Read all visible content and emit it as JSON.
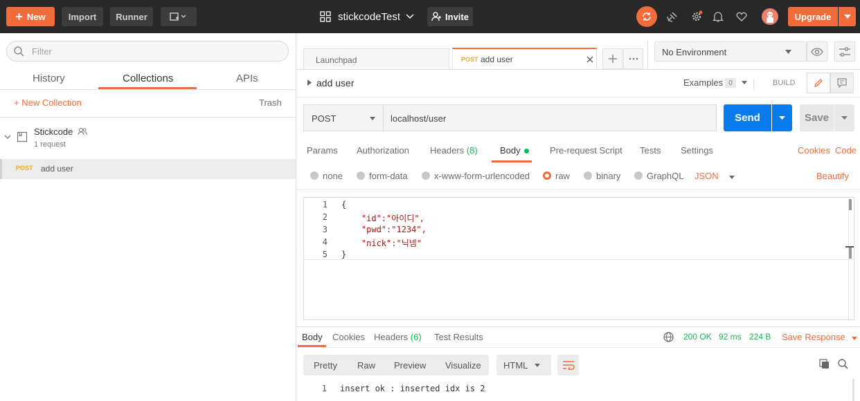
{
  "topbar": {
    "new_label": "New",
    "import_label": "Import",
    "runner_label": "Runner",
    "workspace_name": "stickcodeTest",
    "invite_label": "Invite",
    "upgrade_label": "Upgrade"
  },
  "sidebar": {
    "filter_placeholder": "Filter",
    "tabs": [
      "History",
      "Collections",
      "APIs"
    ],
    "new_collection_label": "+ New Collection",
    "trash_label": "Trash",
    "collection": {
      "name": "Stickcode",
      "count": "1 request"
    },
    "request": {
      "method": "POST",
      "name": "add user"
    }
  },
  "tabs": {
    "launchpad_label": "Launchpad",
    "active_method": "POST",
    "active_name": "add user"
  },
  "env": {
    "selected": "No Environment"
  },
  "request": {
    "name": "add user",
    "examples_label": "Examples",
    "examples_count": "0",
    "build_label": "BUILD",
    "method": "POST",
    "url": "localhost/user",
    "send_label": "Send",
    "save_label": "Save"
  },
  "req_tabs": {
    "params": "Params",
    "authorization": "Authorization",
    "headers": "Headers",
    "headers_count": "(8)",
    "body": "Body",
    "prerequest": "Pre-request Script",
    "tests": "Tests",
    "settings": "Settings",
    "cookies": "Cookies",
    "code": "Code"
  },
  "body_modes": {
    "none": "none",
    "form_data": "form-data",
    "urlencoded": "x-www-form-urlencoded",
    "raw": "raw",
    "binary": "binary",
    "graphql": "GraphQL",
    "json": "JSON",
    "beautify": "Beautify"
  },
  "editor": {
    "line_numbers": [
      "1",
      "2",
      "3",
      "4",
      "5"
    ],
    "lines": [
      "{",
      "    \"id\":\"아이디\",",
      "    \"pwd\":\"1234\",",
      "    \"nick\":\"닉넴\"",
      "}"
    ]
  },
  "response": {
    "tabs": {
      "body": "Body",
      "cookies": "Cookies",
      "headers": "Headers",
      "headers_count": "(6)",
      "test_results": "Test Results"
    },
    "status": "200 OK",
    "time": "92 ms",
    "size": "224 B",
    "save_response": "Save Response",
    "views": {
      "pretty": "Pretty",
      "raw": "Raw",
      "preview": "Preview",
      "visualize": "Visualize"
    },
    "format": "HTML",
    "line_number": "1",
    "line": "insert ok : inserted idx is 2"
  },
  "colors": {
    "accent": "#f26b3a",
    "send": "#097bed",
    "status": "#0cbb52"
  }
}
